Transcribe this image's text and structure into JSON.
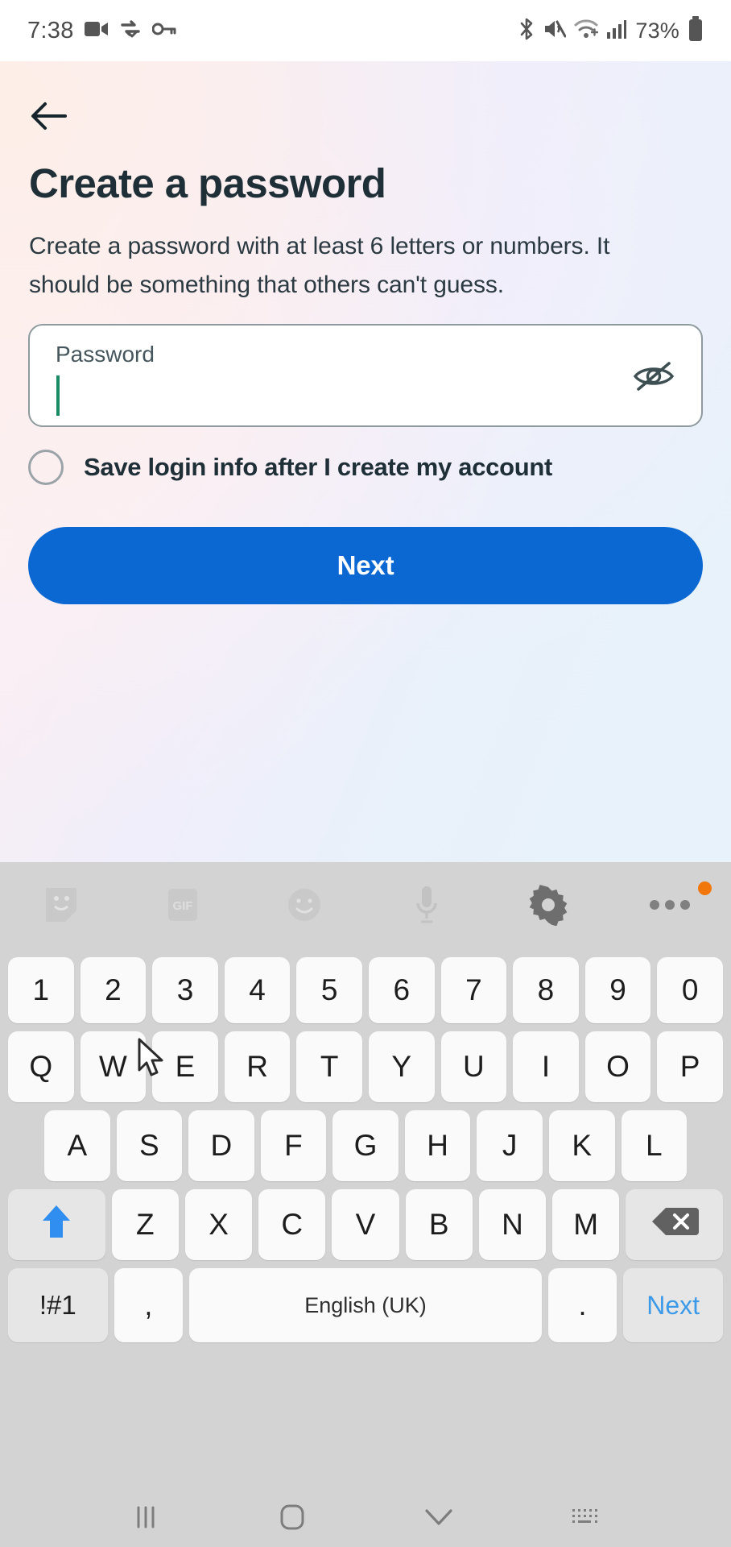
{
  "status_bar": {
    "time": "7:38",
    "battery_percent": "73%",
    "left_icons": [
      "video-camera-icon",
      "sync-check-icon",
      "key-icon"
    ],
    "right_icons": [
      "bluetooth-icon",
      "mute-icon",
      "wifi-icon",
      "cellular-signal-icon",
      "battery-icon"
    ]
  },
  "screen": {
    "back_icon": "back-arrow-icon",
    "title": "Create a password",
    "subtitle": "Create a password with at least 6 letters or numbers. It should be something that others can't guess.",
    "password_field": {
      "label": "Password",
      "value": "",
      "toggle_icon": "eye-off-icon"
    },
    "save_login": {
      "label": "Save login info after I create my account",
      "checked": false
    },
    "next_button": {
      "label": "Next",
      "color": "#0b67d1"
    }
  },
  "keyboard": {
    "toolbar": [
      {
        "name": "sticker-icon"
      },
      {
        "name": "gif-icon",
        "label": "GIF"
      },
      {
        "name": "emoji-icon"
      },
      {
        "name": "microphone-icon"
      },
      {
        "name": "settings-gear-icon"
      },
      {
        "name": "more-options-icon",
        "badge": true
      }
    ],
    "row_numbers": [
      "1",
      "2",
      "3",
      "4",
      "5",
      "6",
      "7",
      "8",
      "9",
      "0"
    ],
    "row_top": [
      "Q",
      "W",
      "E",
      "R",
      "T",
      "Y",
      "U",
      "I",
      "O",
      "P"
    ],
    "row_home": [
      "A",
      "S",
      "D",
      "F",
      "G",
      "H",
      "J",
      "K",
      "L"
    ],
    "row_bottom": {
      "shift": "shift-icon",
      "letters": [
        "Z",
        "X",
        "C",
        "V",
        "B",
        "N",
        "M"
      ],
      "backspace": "backspace-icon"
    },
    "row_space": {
      "symbols": "!#1",
      "comma": ",",
      "space_label": "English (UK)",
      "period": ".",
      "action": "Next"
    }
  },
  "nav_bar": {
    "recents_icon": "recents-icon",
    "home_icon": "home-icon",
    "hide_keyboard_icon": "chevron-down-icon",
    "keyboard_switch_icon": "keyboard-switch-icon"
  }
}
